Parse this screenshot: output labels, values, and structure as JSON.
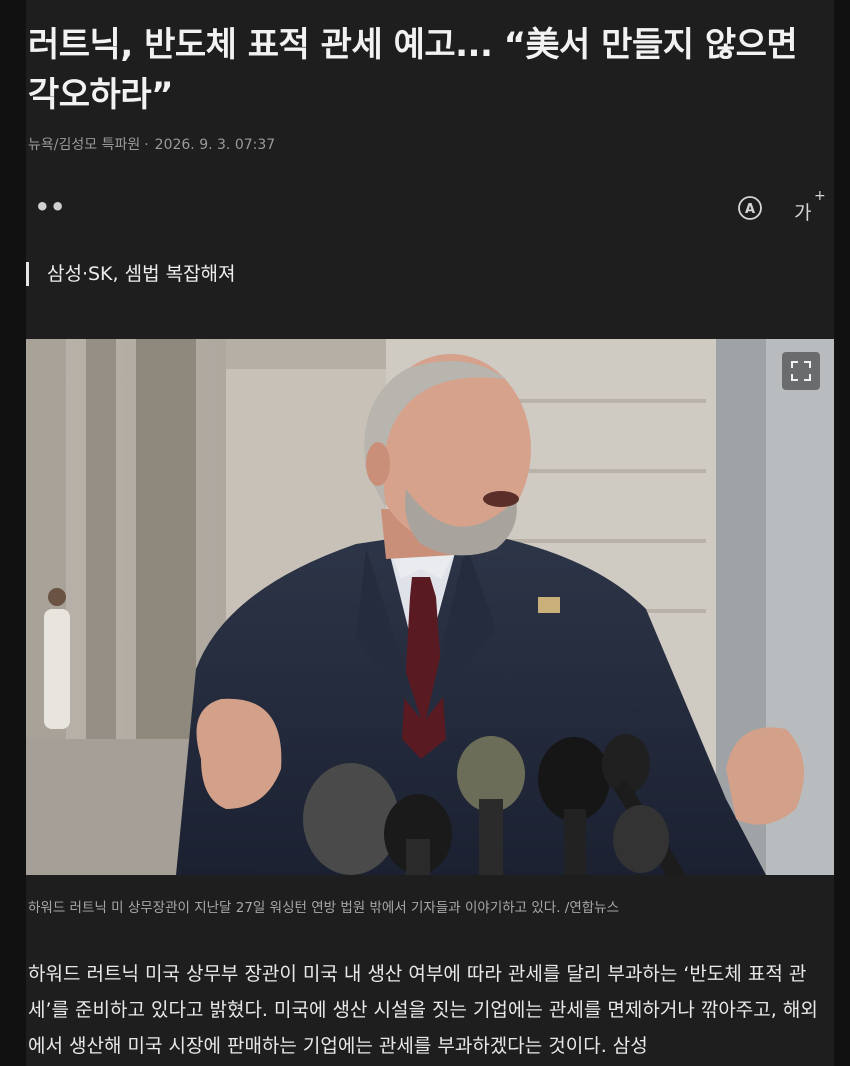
{
  "article": {
    "title": "러트닉, 반도체 표적 관세 예고... “美서 만들지 않으면 각오하라”",
    "byline_author": "뉴욕/김성모 특파원",
    "byline_dot": "·",
    "byline_date": "2026. 9. 3. 07:37",
    "subheading": "삼성·SK, 셈법 복잡해져",
    "photo_caption": "하워드 러트닉 미 상무장관이 지난달 27일 워싱턴 연방 법원 밖에서 기자들과 이야기하고 있다. /연합뉴스",
    "body": "하워드 러트닉 미국 상무부 장관이 미국 내 생산 여부에 따라 관세를 달리 부과하는 ‘반도체 표적 관세’를 준비하고 있다고 밝혔다. 미국에 생산 시설을 짓는 기업에는 관세를 면제하거나 깎아주고, 해외에서 생산해 미국 시장에 판매하는 기업에는 관세를 부과하겠다는 것이다. 삼성"
  },
  "toolbar": {
    "quote_icon": "quote-icon",
    "tts_icon": "read-aloud-icon",
    "font_size_label": "가",
    "font_size_plus": "+"
  },
  "photo": {
    "expand_icon": "expand-icon"
  }
}
